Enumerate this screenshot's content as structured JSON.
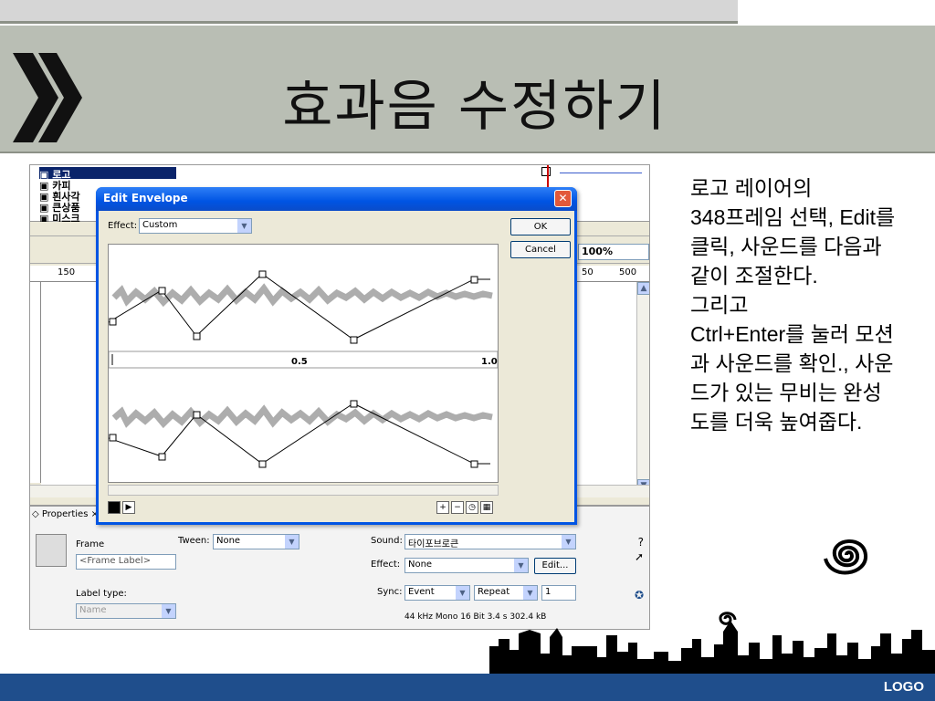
{
  "slide": {
    "title": "효과음 수정하기",
    "description": "로고 레이어의\n348프레임 선택, Edit를 클릭, 사운드를 다음과 같이 조절한다.\n그리고\nCtrl+Enter를 눌러 모션과 사운드를 확인., 사운드가 있는 무비는 완성도를 더욱 높여줍다.",
    "footer_logo": "LOGO"
  },
  "timeline": {
    "layers": [
      "로고",
      "카피",
      "흰사각",
      "큰상품",
      "미스크"
    ],
    "zoom": "100%",
    "ruler_marks": [
      "150",
      "50",
      "500"
    ]
  },
  "dialog": {
    "title": "Edit Envelope",
    "effect_label": "Effect:",
    "effect_value": "Custom",
    "ok_label": "OK",
    "cancel_label": "Cancel",
    "ruler_labels": [
      "0.5",
      "1.0"
    ]
  },
  "properties": {
    "tab_label": "Properties",
    "frame_label": "Frame",
    "frame_placeholder": "<Frame Label>",
    "label_type_label": "Label type:",
    "label_type_value": "Name",
    "tween_label": "Tween:",
    "tween_value": "None",
    "sound_label": "Sound:",
    "sound_value": "타이포브로큰",
    "effect_label": "Effect:",
    "effect_value": "None",
    "edit_button": "Edit...",
    "sync_label": "Sync:",
    "sync_value": "Event",
    "repeat_value": "Repeat",
    "repeat_count": "1",
    "sound_info": "44 kHz Mono 16 Bit 3.4 s 302.4 kB"
  },
  "colors": {
    "title_bar": "#b9beb4",
    "dialog_title": "#0054e3",
    "footer": "#1f4e8c"
  }
}
